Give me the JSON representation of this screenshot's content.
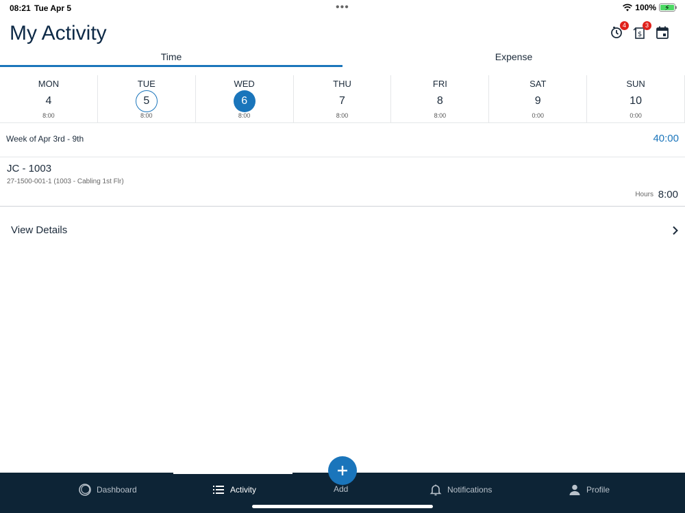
{
  "status_bar": {
    "time": "08:21",
    "date": "Tue Apr 5",
    "battery": "100%"
  },
  "header": {
    "title": "My Activity",
    "icons": [
      {
        "name": "timer-icon",
        "badge": "4"
      },
      {
        "name": "expense-icon",
        "badge": "3"
      },
      {
        "name": "calendar-icon"
      }
    ]
  },
  "tabs": [
    {
      "label": "Time",
      "active": true
    },
    {
      "label": "Expense",
      "active": false
    }
  ],
  "week": {
    "days": [
      {
        "name": "MON",
        "num": "4",
        "hours": "8:00"
      },
      {
        "name": "TUE",
        "num": "5",
        "hours": "8:00"
      },
      {
        "name": "WED",
        "num": "6",
        "hours": "8:00"
      },
      {
        "name": "THU",
        "num": "7",
        "hours": "8:00"
      },
      {
        "name": "FRI",
        "num": "8",
        "hours": "8:00"
      },
      {
        "name": "SAT",
        "num": "9",
        "hours": "0:00"
      },
      {
        "name": "SUN",
        "num": "10",
        "hours": "0:00"
      }
    ],
    "label": "Week of Apr 3rd - 9th",
    "total": "40:00"
  },
  "entry": {
    "title": "JC - 1003",
    "subtitle": "27-1500-001-1 (1003 - Cabling 1st Flr)",
    "hours_label": "Hours",
    "hours": "8:00"
  },
  "view_details": {
    "label": "View Details"
  },
  "nav": {
    "dashboard": "Dashboard",
    "activity": "Activity",
    "add": "Add",
    "notifications": "Notifications",
    "profile": "Profile"
  },
  "colors": {
    "accent": "#1a75bb",
    "nav_bg": "#0d2436",
    "badge": "#e0211b"
  }
}
